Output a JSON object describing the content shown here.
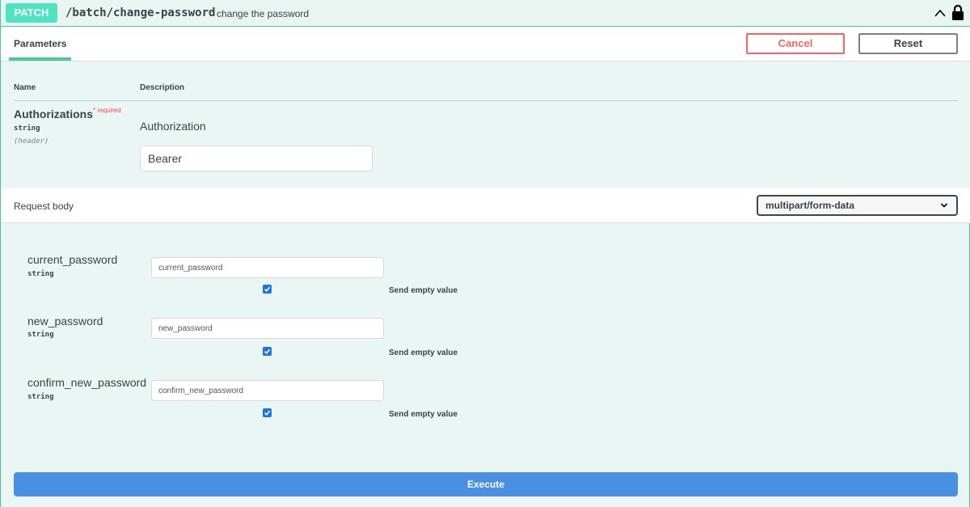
{
  "header": {
    "method": "PATCH",
    "path": "/batch/change-password",
    "summary": "change the password"
  },
  "tabs": {
    "parameters_label": "Parameters",
    "cancel_label": "Cancel",
    "reset_label": "Reset"
  },
  "parameters": {
    "name_col": "Name",
    "description_col": "Description",
    "items": [
      {
        "name": "Authorizations",
        "required_label": "* required",
        "type": "string",
        "in": "(header)",
        "description": "Authorization",
        "value": "Bearer"
      }
    ]
  },
  "request_body": {
    "title": "Request body",
    "content_type": "multipart/form-data",
    "fields": [
      {
        "name": "current_password",
        "type": "string",
        "placeholder": "current_password",
        "send_empty_label": "Send empty value",
        "send_empty_checked": true
      },
      {
        "name": "new_password",
        "type": "string",
        "placeholder": "new_password",
        "send_empty_label": "Send empty value",
        "send_empty_checked": true
      },
      {
        "name": "confirm_new_password",
        "type": "string",
        "placeholder": "confirm_new_password",
        "send_empty_label": "Send empty value",
        "send_empty_checked": true
      }
    ]
  },
  "execute_label": "Execute",
  "colors": {
    "method_patch": "#50e3c2",
    "border": "#49cc90",
    "cancel": "#ff6060",
    "execute": "#4990e2",
    "required": "#ff4545"
  },
  "icons": {
    "collapse": "chevron-up-icon",
    "lock": "lock-icon",
    "select": "chevron-down-icon",
    "checkbox": "checkmark-icon"
  }
}
